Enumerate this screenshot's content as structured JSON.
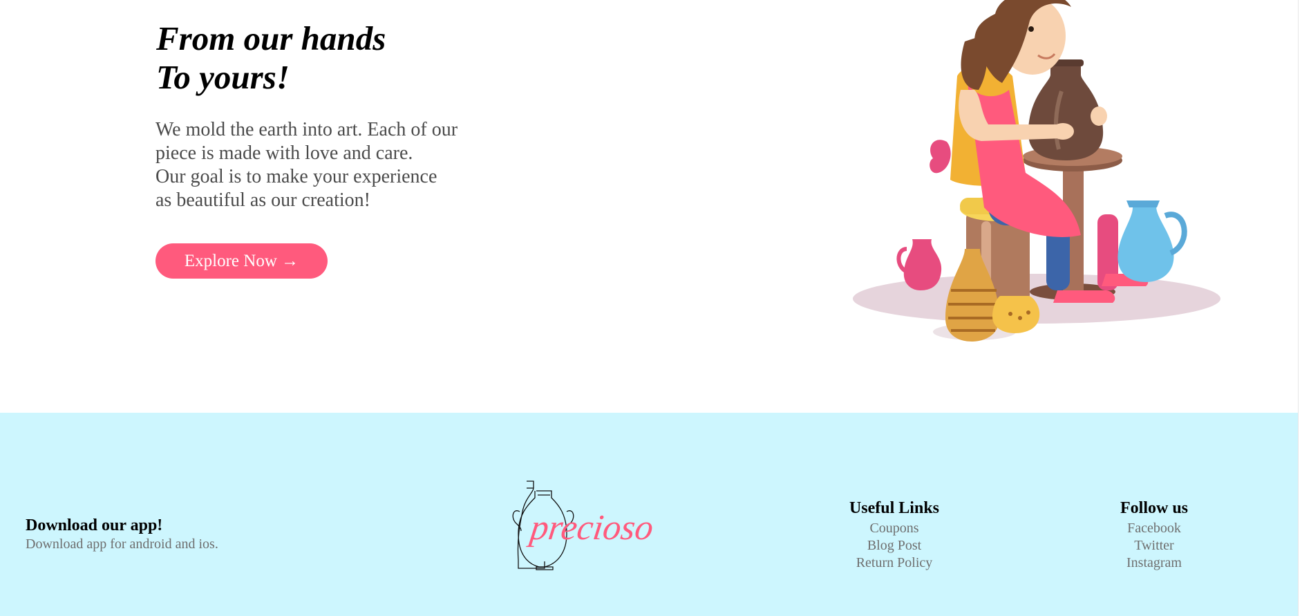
{
  "hero": {
    "title_line1": "From our hands",
    "title_line2": "To yours!",
    "text_line1": "We mold the earth into art. Each of our",
    "text_line2": "piece is made with love and care.",
    "text_line3": "Our goal is to make your experience",
    "text_line4": "as beautiful as our creation!",
    "cta_label": "Explore Now →",
    "illustration_icon": "girl-making-pottery-illustration"
  },
  "footer": {
    "app": {
      "title": "Download our app!",
      "subtitle": "Download app for android and ios."
    },
    "brand": {
      "logo_text": "precioso",
      "logo_icon": "vase-outline-icon"
    },
    "useful_links": {
      "heading": "Useful Links",
      "items": [
        "Coupons",
        "Blog Post",
        "Return Policy"
      ]
    },
    "follow_us": {
      "heading": "Follow us",
      "items": [
        "Facebook",
        "Twitter",
        "Instagram"
      ]
    }
  },
  "colors": {
    "accent": "#ff5a7d",
    "footer_bg": "#cdf6fe",
    "muted_text": "#6e6e6e",
    "body_text": "#4a4a4a"
  }
}
